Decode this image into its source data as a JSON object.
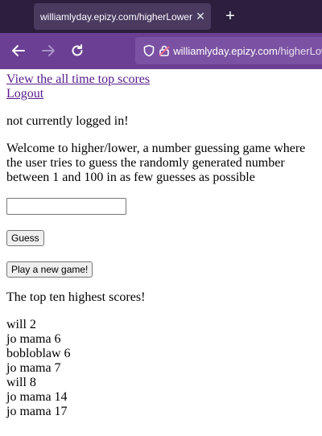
{
  "browser": {
    "tab_title": "williamlyday.epizy.com/higherLower",
    "tab_close": "✕",
    "new_tab": "+",
    "url_prefix": "",
    "url_host": "williamlyday.epizy.com",
    "url_path": "/higherLower"
  },
  "page": {
    "link_top_scores": "View the all time top scores",
    "link_logout": "Logout",
    "login_status": "not currently logged in!",
    "welcome": "Welcome to higher/lower, a number guessing game where the user tries to guess the randomly generated number between 1 and 100 in as few guesses as possible",
    "guess_input_value": "",
    "guess_button": "Guess",
    "new_game_button": "Play a new game!",
    "scores_heading": "The top ten highest scores!",
    "scores": [
      "will 2",
      "jo mama 6",
      "bobloblaw 6",
      "jo mama 7",
      "will 8",
      "jo mama 14",
      "jo mama 17"
    ]
  }
}
